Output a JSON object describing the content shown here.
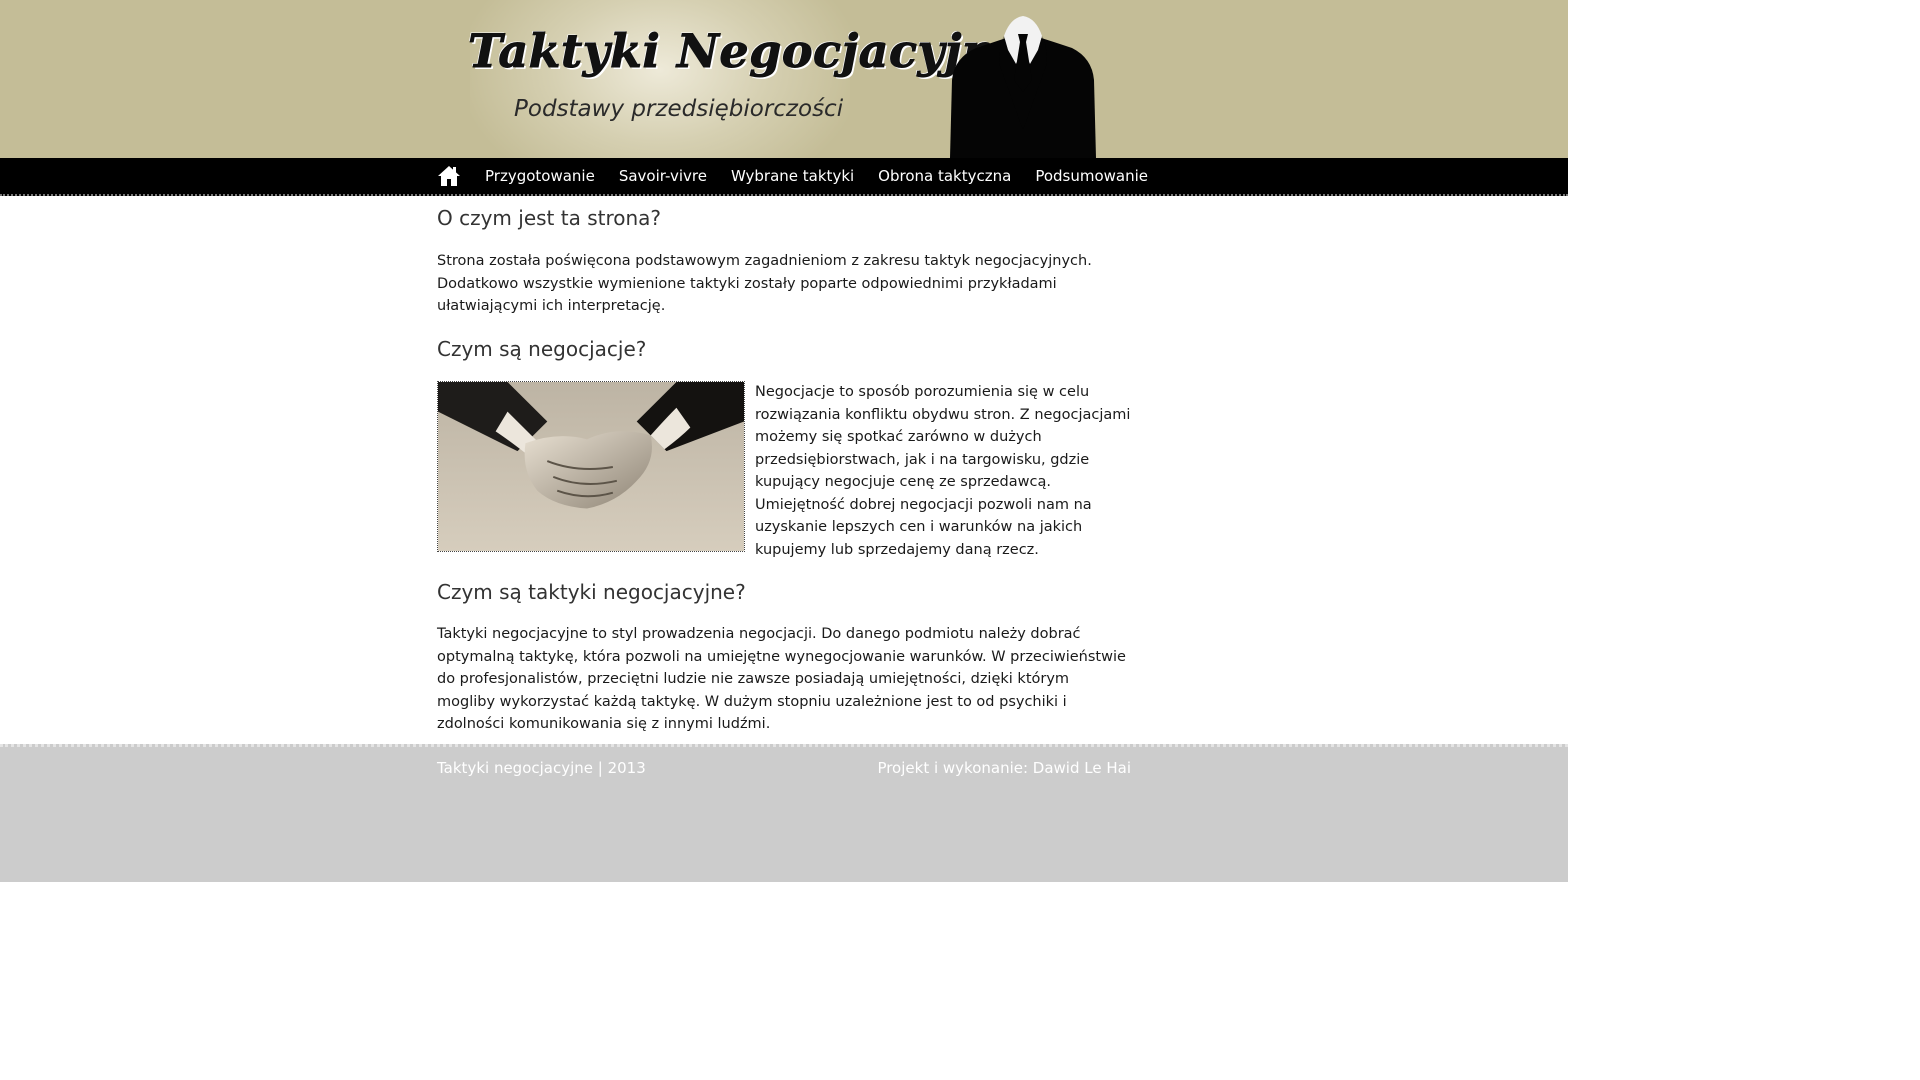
{
  "header": {
    "title": "Taktyki Negocjacyjne",
    "subtitle": "Podstawy przedsiębiorczości"
  },
  "nav": {
    "home_icon": "home-icon",
    "items": [
      {
        "label": "Przygotowanie"
      },
      {
        "label": "Savoir-vivre"
      },
      {
        "label": "Wybrane taktyki"
      },
      {
        "label": "Obrona taktyczna"
      },
      {
        "label": "Podsumowanie"
      }
    ]
  },
  "main": {
    "sections": [
      {
        "heading": "O czym jest ta strona?",
        "text": "Strona została poświęcona podstawowym zagadnieniom z zakresu taktyk negocjacyjnych. Dodatkowo wszystkie wymienione taktyki zostały poparte odpowiednimi przykładami ułatwiającymi ich interpretację."
      },
      {
        "heading": "Czym są negocjacje?",
        "text": "Negocjacje to sposób porozumienia się w celu rozwiązania konfliktu obydwu stron. Z negocjacjami możemy się spotkać zarówno w dużych przedsiębiorstwach, jak i na targowisku, gdzie kupujący negocjuje cenę ze sprzedawcą. Umiejętność dobrej negocjacji pozwoli nam na uzyskanie lepszych cen i warunków na jakich kupujemy lub sprzedajemy daną rzecz."
      },
      {
        "heading": "Czym są taktyki negocjacyjne?",
        "text": "Taktyki negocjacyjne to styl prowadzenia negocjacji. Do danego podmiotu należy dobrać optymalną taktykę, która pozwoli na umiejętne wynegocjowanie warunków. W przeciwieństwie do profesjonalistów, przeciętni ludzie nie zawsze posiadają umiejętności, dzięki którym mogliby wykorzystać każdą taktykę. W dużym stopniu uzależnione jest to od psychiki i zdolności komunikowania się z innymi ludźmi."
      }
    ]
  },
  "footer": {
    "left": "Taktyki negocjacyjne | 2013",
    "right": "Projekt i wykonanie: Dawid Le Hai"
  },
  "colors": {
    "header_bg": "#c4bd97",
    "nav_bg": "#000000",
    "footer_bg": "#cccccc"
  }
}
